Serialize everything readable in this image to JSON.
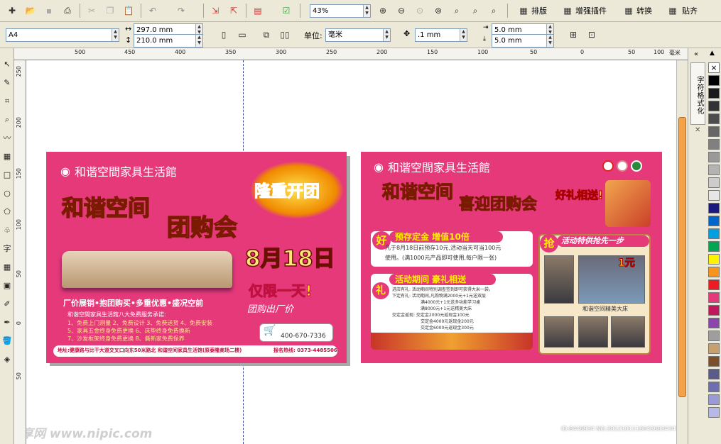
{
  "toolbar1": {
    "zoom": "43%",
    "layout_label": "排版",
    "plugins_label": "增强插件",
    "convert_label": "转换",
    "snap_label": "贴齐"
  },
  "toolbar2": {
    "page_size": "A4",
    "width": "297.0 mm",
    "height": "210.0 mm",
    "units_label": "单位:",
    "units_value": "毫米",
    "nudge": ".1 mm",
    "dup_x": "5.0 mm",
    "dup_y": "5.0 mm"
  },
  "ruler": {
    "h_labels": [
      "500",
      "450",
      "400",
      "350",
      "300",
      "250",
      "200",
      "150",
      "100",
      "50",
      "0",
      "50",
      "100"
    ],
    "unit": "毫米",
    "v_labels": [
      "250",
      "200",
      "150",
      "100",
      "50",
      "0",
      "50"
    ]
  },
  "docker": {
    "tab_label": "字符格式化"
  },
  "palette": [
    "#ffffff",
    "#000000",
    "#1a1a1a",
    "#333333",
    "#4d4d4d",
    "#666666",
    "#808080",
    "#999999",
    "#b3b3b3",
    "#cccccc",
    "#e6e6e6",
    "#1a1a80",
    "#0066cc",
    "#00a0e0",
    "#00a651",
    "#fff200",
    "#f7941d",
    "#ed1c24",
    "#e5397a",
    "#c2185b",
    "#8e44ad",
    "#9e9e9e",
    "#c8a06e",
    "#7b4f2c",
    "#5b5b8a",
    "#6f6fb0",
    "#9a9ad6",
    "#b7b7e8"
  ],
  "left_page": {
    "store_name": "和谐空間家具生活館",
    "burst_text": "隆重开团",
    "headline1": "和谐空间",
    "headline2": "团购会",
    "date_text": "8月18日",
    "limited_text": "仅限一天!",
    "group_buy_price": "团购出厂价",
    "slogan": "厂价展销•抱团购买•多重优惠•盛况空前",
    "promise_title": "和谐空間家具生活館八大免费服务承诺:",
    "promise_items": [
      "1、免费上门测量  2、免费设计  3、免费送货  4、免费安装",
      "5、家具五金终身免费更换  6、床垫终身免费换新",
      "7、沙发框架终身免费更换  8、撕新家免费保养"
    ],
    "phone_badge": "400-670-7336",
    "address": "地址:健康路与比干大道交叉口向东50米路北  和谐空间家具生活馆(原泰隆商场二楼)",
    "hotline": "报名热线: 0373-4485506"
  },
  "right_page": {
    "store_name": "和谐空間家具生活館",
    "headline1": "和谐空间",
    "headline2": "喜迎团购会",
    "gift_text": "好礼相送!",
    "deposit_badge": "好",
    "deposit_title": "预存定金 增值10倍",
    "deposit_line1": "凡于8月18日前预存10元,活动当天可当100元",
    "deposit_line2": "使用。(满1000元产品即可使用,每户限一张)",
    "gift_badge": "礼",
    "gift_title": "活动期间 豪礼相送",
    "gift_lines": [
      "进店有礼:  活动期间特别调查签到即可获得大米一袋。",
      "下定有礼:  活动期间,凡购物满2000元+1元送双层",
      "满4000元+1元送多功能学习桌",
      "满8000元+1元送精美大床",
      "交定金返现:  交定金2000元返现金100元",
      "交定金4000元返现金200元",
      "交定金6000元返现金300元"
    ],
    "grab_badge": "抢",
    "grab_title": "活动特供抢先一步",
    "price_badge": "1元",
    "bed_caption": "和谐空间精美大床"
  },
  "watermark": {
    "logo": "昵享网 www.nipic.com",
    "id_text": "ID:8446934 NO:20121011160436034347"
  }
}
